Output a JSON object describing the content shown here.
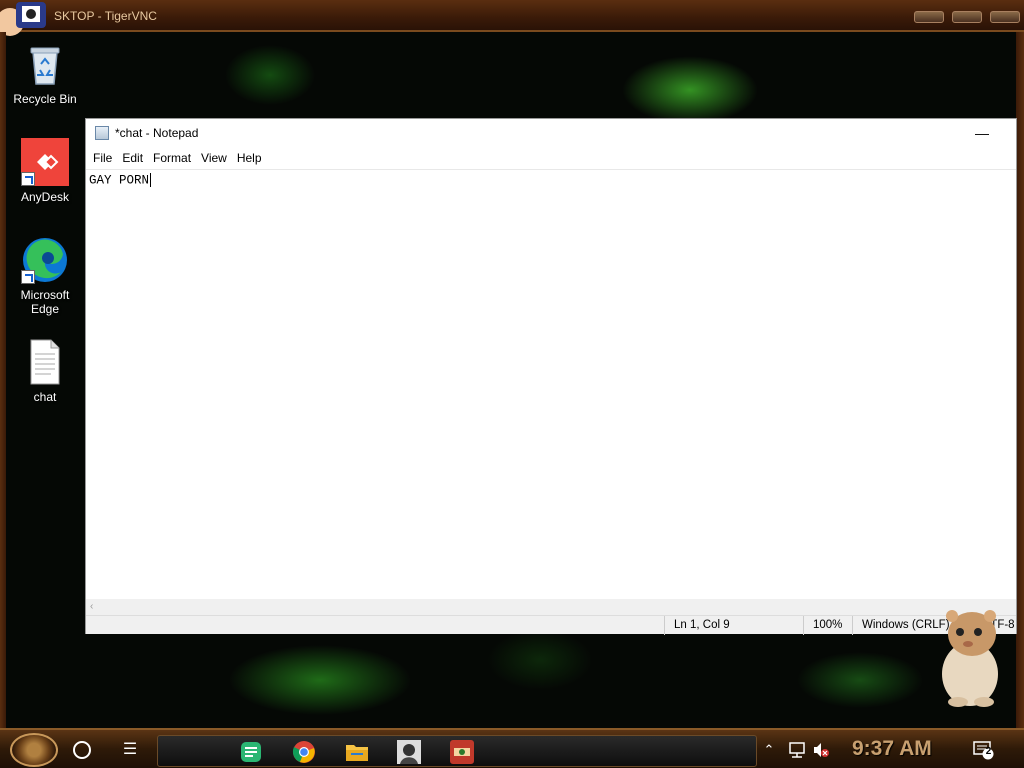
{
  "vnc": {
    "title": "SKTOP - TigerVNC"
  },
  "desktop": {
    "icons": [
      {
        "label": "Recycle Bin",
        "icon": "recycle-bin-icon"
      },
      {
        "label": "AnyDesk",
        "icon": "anydesk-icon"
      },
      {
        "label": "Microsoft Edge",
        "icon": "edge-icon"
      },
      {
        "label": "chat",
        "icon": "text-file-icon"
      }
    ]
  },
  "notepad": {
    "title": "*chat - Notepad",
    "menu": [
      "File",
      "Edit",
      "Format",
      "View",
      "Help"
    ],
    "content": "GAY PORN",
    "status": {
      "position": "Ln 1, Col 9",
      "zoom": "100%",
      "line_ending": "Windows (CRLF)",
      "encoding": "UTF-8"
    }
  },
  "taskbar": {
    "clock": "9:37 AM",
    "notification_count": "2",
    "pinned": [
      "notes-app-icon",
      "chrome-icon",
      "file-explorer-icon",
      "portrait-app-icon",
      "red-app-icon"
    ]
  },
  "colors": {
    "taskbar_bg": "#2e1a08",
    "clock": "#c8a070",
    "anydesk": "#ef443b"
  }
}
